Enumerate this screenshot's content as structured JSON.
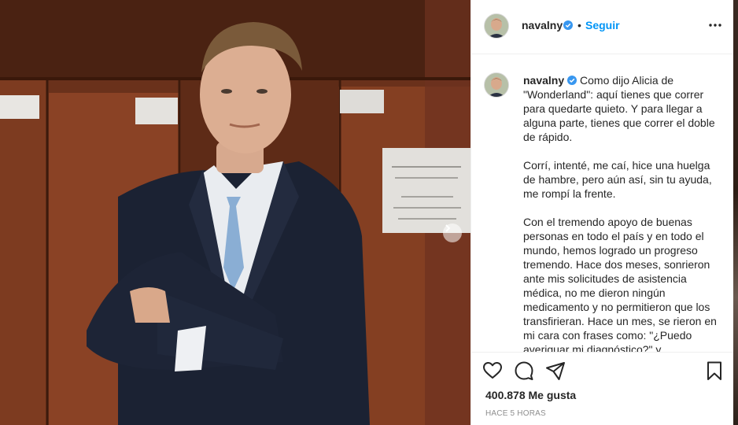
{
  "post": {
    "username": "navalny",
    "follow_label": "Seguir",
    "separator": "•",
    "caption_paragraphs": [
      "Como dijo Alicia de \"Wonderland\": aquí tienes que correr para quedarte quieto. Y para llegar a alguna parte, tienes que correr el doble de rápido.",
      "Corrí, intenté, me caí, hice una huelga de hambre, pero aún así, sin tu ayuda, me rompí la frente.",
      "Con el tremendo apoyo de buenas personas en todo el país y en todo el mundo, hemos logrado un progreso tremendo. Hace dos meses, sonrieron ante mis solicitudes de asistencia médica, no me dieron ningún medicamento y no permitieron que los transfirieran. Hace un mes, se rieron en mi cara con frases como: \"¿Puedo averiguar mi diagnóstico?\" y"
    ],
    "likes": "400.878 Me gusta",
    "timestamp": "HACE 5 HORAS"
  },
  "icons": {
    "verified": "verified-badge-icon",
    "more": "more-options-icon",
    "like": "heart-icon",
    "comment": "comment-icon",
    "share": "paper-plane-icon",
    "save": "bookmark-icon",
    "next": "chevron-right-icon"
  },
  "colors": {
    "accent": "#0095f6",
    "text": "#262626",
    "muted": "#8e8e8e",
    "border": "#efefef"
  }
}
